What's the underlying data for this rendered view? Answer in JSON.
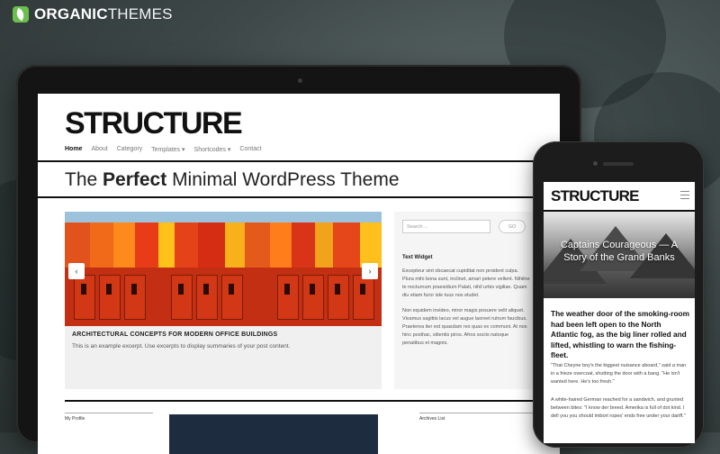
{
  "brand": {
    "name_bold": "ORGANIC",
    "name_light": "THEMES"
  },
  "laptop_site": {
    "title": "STRUCTURE",
    "nav": [
      "Home",
      "About",
      "Category",
      "Templates ▾",
      "Shortcodes ▾",
      "Contact"
    ],
    "tagline": {
      "pre": "The ",
      "bold": "Perfect",
      "post": " Minimal WordPress Theme"
    },
    "slider": {
      "caption": "ARCHITECTURAL CONCEPTS FOR MODERN OFFICE BUILDINGS",
      "excerpt": "This is an example excerpt. Use excerpts to display summaries of your post content.",
      "prev_icon": "‹",
      "next_icon": "›"
    },
    "sidebar": {
      "search_placeholder": "Search ...",
      "search_button": "GO",
      "widget_title": "Text Widget",
      "para1": "Excepteur sint obcaecat cupiditat non proident culpa. Plura mihi bona sunt, inclinet, amari petere vellent. Nihilne te nocturnum praesidium Palati, nihil urbis vigiliae. Quam diu etiam furor iste tuus nos eludet.",
      "para2": "Non equidem invideo, miror magis posuere velit aliquet. Vivamus sagittis lacus vel augue laoreet rutrum faucibus. Praeterea iter est quasdam res quas ex communi. At nos hinc posthac, sitientis piros. Afros sociis natoque penatibus et magnis."
    },
    "lower": {
      "left_label": "My Profile",
      "right_label": "Archives List"
    }
  },
  "phone_site": {
    "title": "STRUCTURE",
    "hero_title": "Captains Courageous — A Story of the Grand Banks",
    "lead": "The weather door of the smoking-room had been left open to the North Atlantic fog, as the big liner rolled and lifted, whistling to warn the fishing-fleet.",
    "para1": "\"That Cheyne boy's the biggest nuisance aboard,\" said a man in a frieze overcoat, shutting the door with a bang. \"He isn't wanted here. He's too fresh.\"",
    "para2": "A white-haired German reached for a sandwich, and grunted between bites: \"I know der breed. Amerika is full of dot kind. I dell you you should imbort ropes' ends free under your dariff.\""
  }
}
